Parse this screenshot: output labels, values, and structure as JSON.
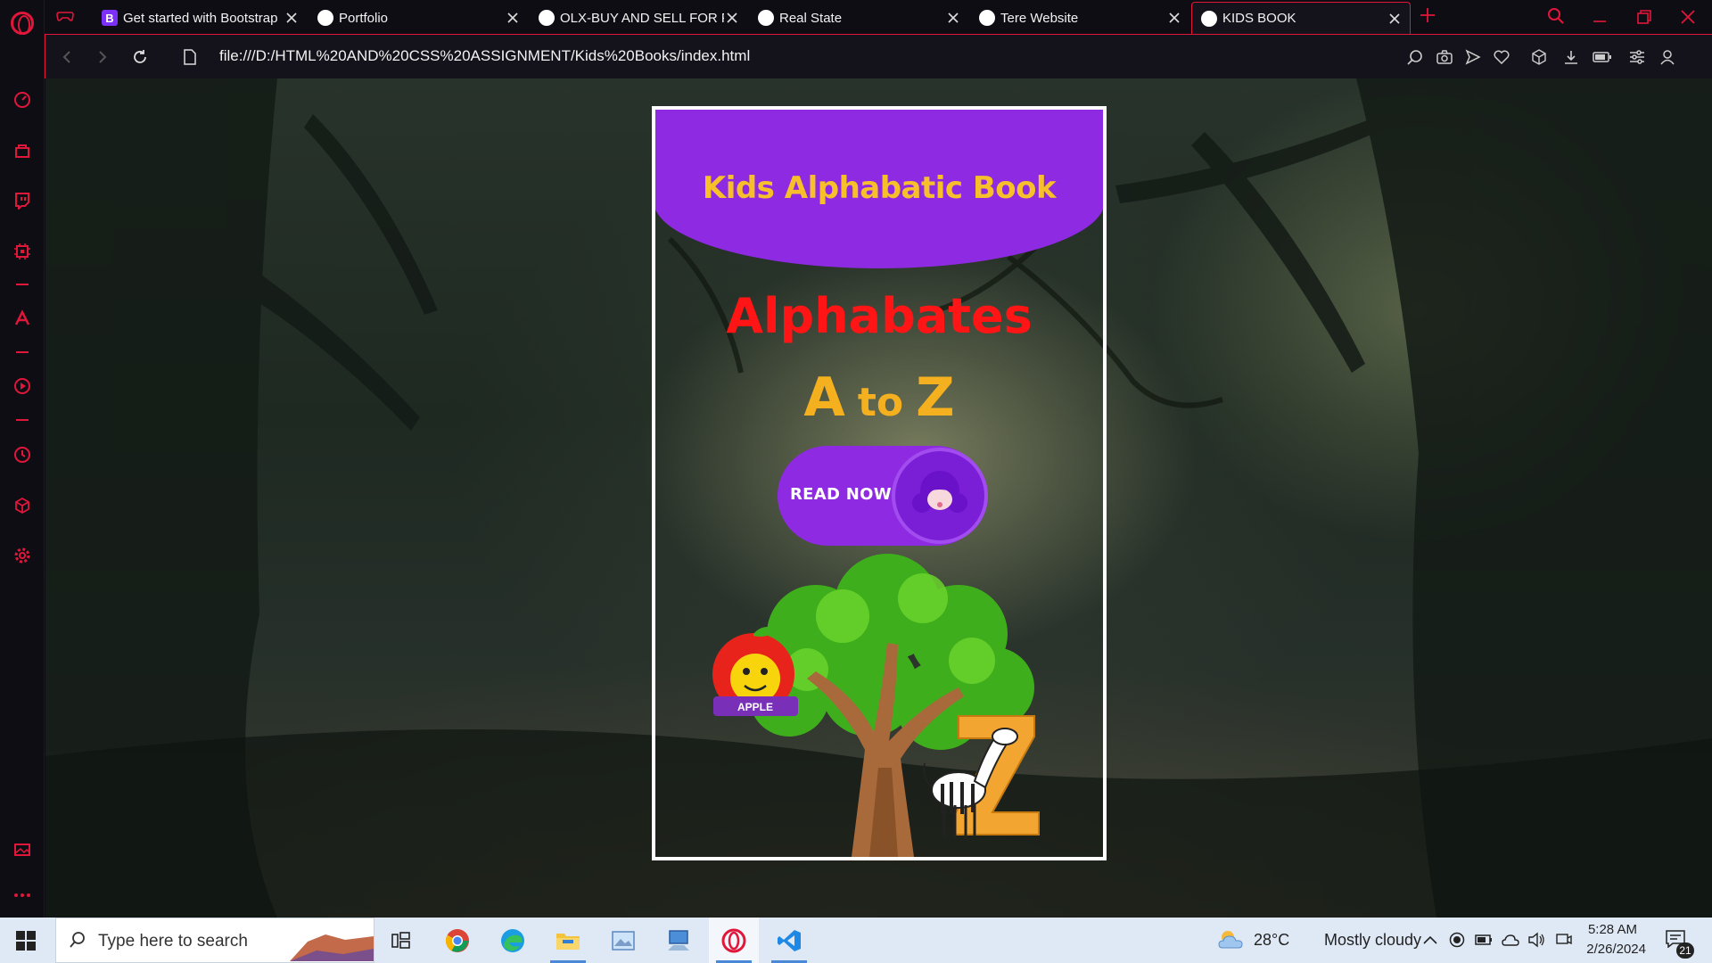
{
  "browser": {
    "tabs": [
      {
        "title": "Get started with Bootstrap",
        "favicon": "bootstrap-icon"
      },
      {
        "title": "Portfolio",
        "favicon": "globe-icon"
      },
      {
        "title": "OLX-BUY AND SELL FOR FREE",
        "favicon": "globe-icon"
      },
      {
        "title": "Real State",
        "favicon": "globe-icon"
      },
      {
        "title": "Tere Website",
        "favicon": "globe-icon"
      },
      {
        "title": "KIDS BOOK",
        "favicon": "globe-icon",
        "active": true
      }
    ],
    "address": "file:///D:/HTML%20AND%20CSS%20ASSIGNMENT/Kids%20Books/index.html",
    "accent_color": "#e0163b"
  },
  "page": {
    "title": "Kids Alphabatic Book",
    "heading": "Alphabates",
    "range": {
      "from": "A",
      "joiner": "to",
      "to": "Z"
    },
    "read_button": "READ NOW",
    "apple_label": "APPLE",
    "colors": {
      "purple": "#8e2be2",
      "title_yellow": "#f7c02a",
      "heading_red": "#ff1515",
      "range_orange": "#f4b01e"
    }
  },
  "taskbar": {
    "search_placeholder": "Type here to search",
    "weather_temp": "28°C",
    "weather_desc": "Mostly cloudy",
    "time": "5:28 AM",
    "date": "2/26/2024",
    "notifications": "21"
  }
}
